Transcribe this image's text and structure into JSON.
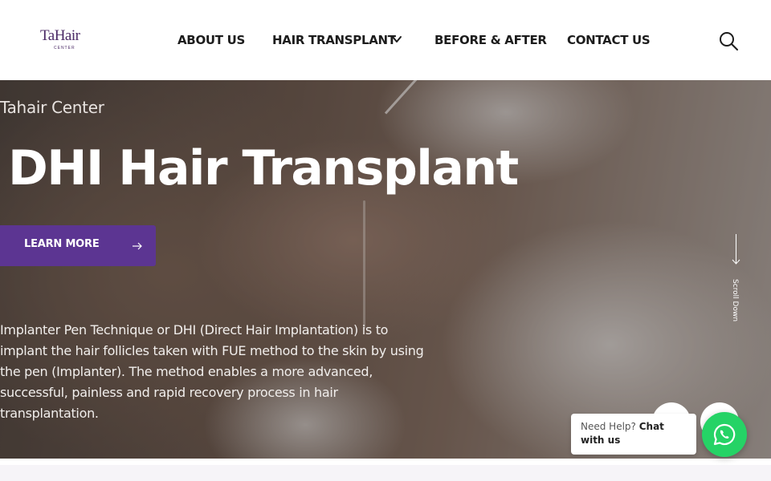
{
  "header": {
    "logo": {
      "text": "TaHair",
      "subtext": "CENTER",
      "color": "#4b2a66"
    },
    "nav": {
      "about": "ABOUT US",
      "hair_transplant": "HAIR TRANSPLANT",
      "before_after": "BEFORE & AFTER",
      "contact": "CONTACT US"
    },
    "search_icon": "search-icon"
  },
  "hero": {
    "kicker": "Tahair Center",
    "title": "DHI Hair Transplant",
    "button_label": "LEARN MORE",
    "button_color": "#5c3592",
    "description": "Implanter Pen Technique or DHI (Direct Hair Implantation) is to implant the hair follicles taken with FUE method to the skin by using the pen (Implanter). The method enables a more advanced, successful, painless and rapid recovery process in hair transplantation.",
    "scroll_label": "Scroll Down"
  },
  "chat": {
    "prefix": "Need Help?",
    "strong": "Chat with us",
    "icon": "whatsapp-icon",
    "color": "#25d366"
  }
}
